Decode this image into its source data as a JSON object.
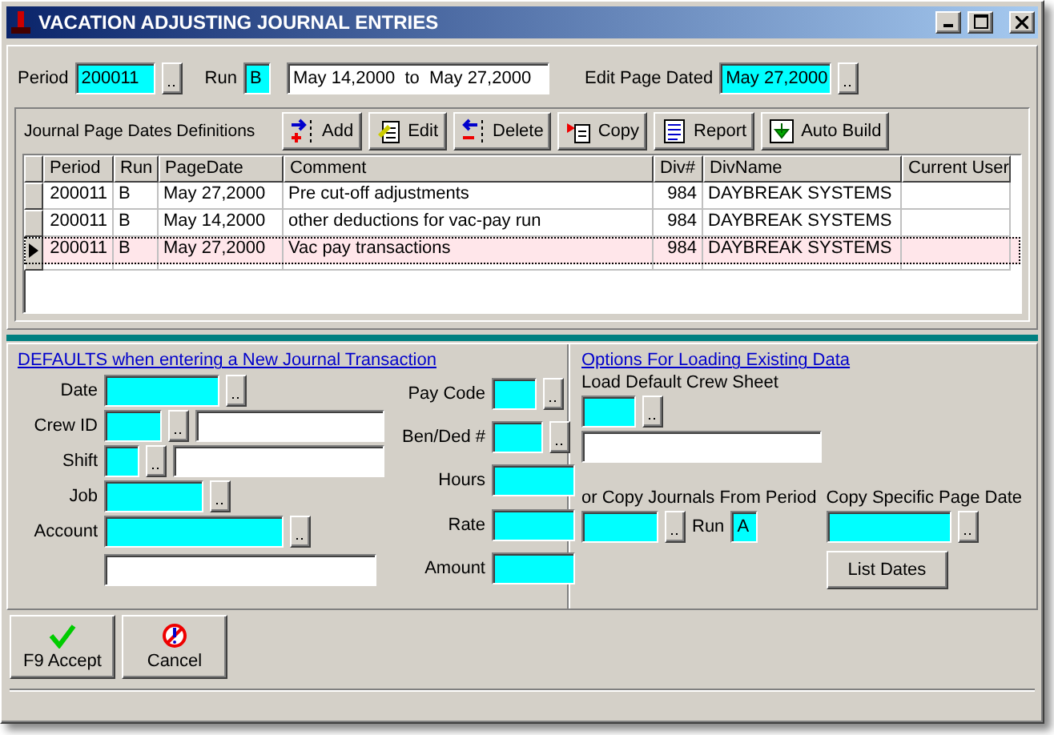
{
  "window": {
    "title": "VACATION ADJUSTING JOURNAL ENTRIES"
  },
  "header": {
    "period_label": "Period",
    "period": "200011",
    "run_label": "Run",
    "run": "B",
    "range": "May 14,2000  to  May 27,2000",
    "edit_label": "Edit Page Dated",
    "edit_date": "May 27,2000"
  },
  "toolbar": {
    "title": "Journal Page Dates Definitions",
    "buttons": [
      {
        "label": "Add",
        "kind": "add"
      },
      {
        "label": "Edit",
        "kind": "edit"
      },
      {
        "label": "Delete",
        "kind": "delete"
      },
      {
        "label": "Copy",
        "kind": "copy"
      },
      {
        "label": "Report",
        "kind": "report"
      },
      {
        "label": "Auto Build",
        "kind": "build"
      }
    ]
  },
  "table": {
    "columns": [
      "Period",
      "Run",
      "PageDate",
      "Comment",
      "Div#",
      "DivName",
      "Current User"
    ],
    "rows": [
      {
        "cells": [
          "200011",
          "B",
          "May 27,2000",
          "Pre cut-off adjustments",
          "984",
          "DAYBREAK SYSTEMS",
          ""
        ],
        "selected": false
      },
      {
        "cells": [
          "200011",
          "B",
          "May 14,2000",
          "other deductions for vac-pay run",
          "984",
          "DAYBREAK SYSTEMS",
          ""
        ],
        "selected": false
      },
      {
        "cells": [
          "200011",
          "B",
          "May 27,2000",
          "Vac pay transactions",
          "984",
          "DAYBREAK SYSTEMS",
          ""
        ],
        "selected": true
      }
    ]
  },
  "defaults": {
    "title": "DEFAULTS when entering a New Journal Transaction",
    "left": [
      {
        "label": "Date",
        "kind": "lookup"
      },
      {
        "label": "Crew ID",
        "kind": "lookup_desc"
      },
      {
        "label": "Shift",
        "kind": "lookup_desc"
      },
      {
        "label": "Job",
        "kind": "lookup"
      },
      {
        "label": "Account",
        "kind": "lookup_below"
      }
    ],
    "right": [
      {
        "label": "Pay Code",
        "kind": "lookup"
      },
      {
        "label": "Ben/Ded #",
        "kind": "lookup"
      },
      {
        "label": "Hours",
        "kind": "plain"
      },
      {
        "label": "Rate",
        "kind": "plain"
      },
      {
        "label": "Amount",
        "kind": "plain"
      }
    ]
  },
  "options": {
    "title": "Options For Loading Existing Data",
    "crew_label": "Load Default Crew Sheet",
    "copy_label": "or Copy Journals From Period",
    "run_label": "Run",
    "run": "A",
    "page_label": "Copy Specific Page Date",
    "list_button": "List Dates"
  },
  "buttons": [
    {
      "label": "F9  Accept",
      "kind": "accept"
    },
    {
      "label": "Cancel",
      "kind": "cancel"
    }
  ]
}
